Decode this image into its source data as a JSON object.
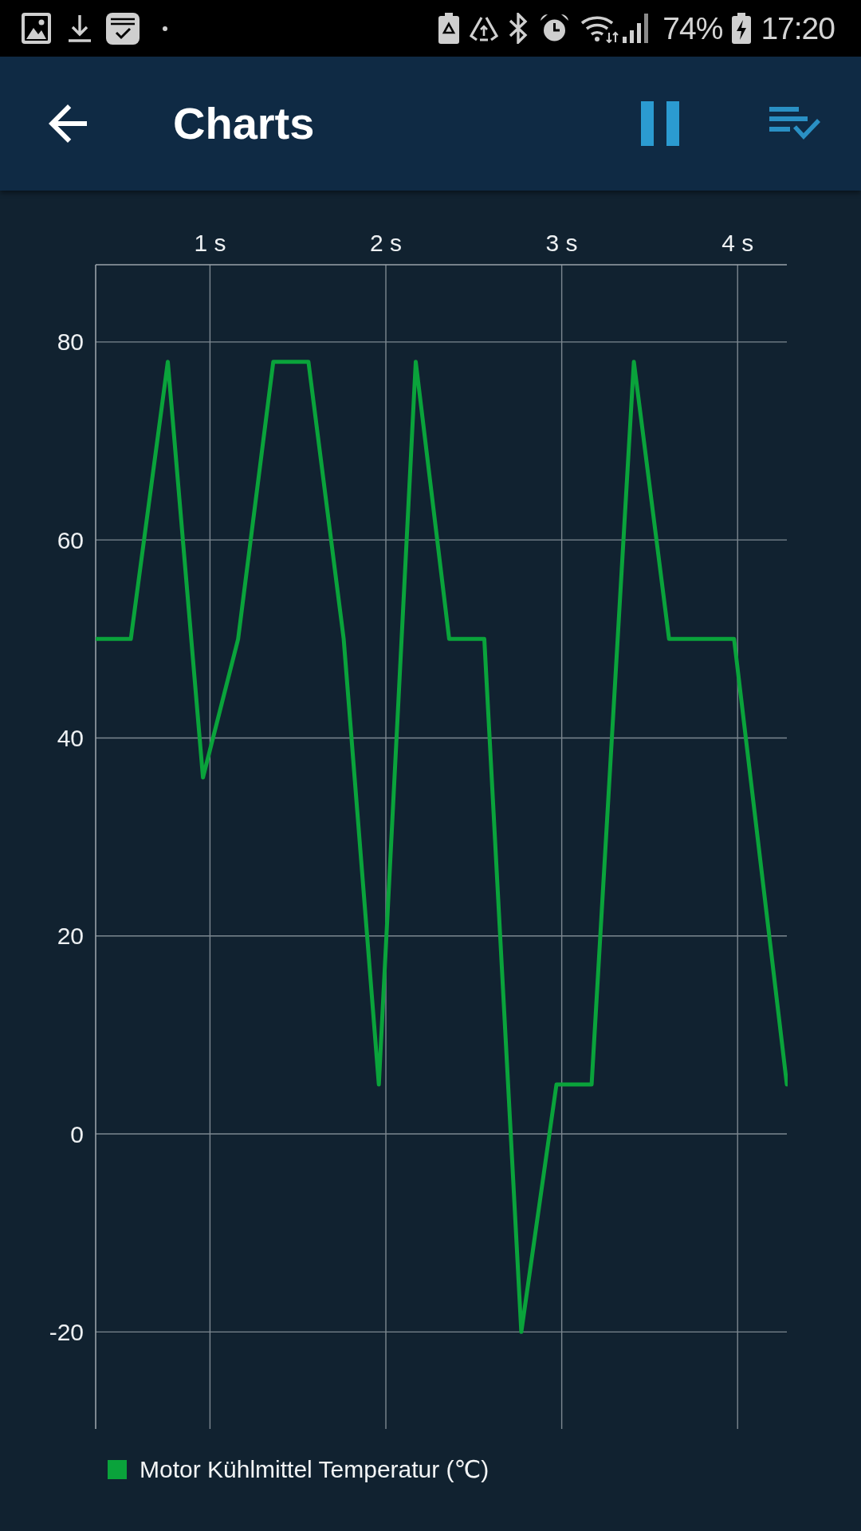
{
  "status_bar": {
    "battery": "74%",
    "time": "17:20"
  },
  "app_bar": {
    "title": "Charts"
  },
  "chart": {
    "chart_data": {
      "type": "line",
      "x": [
        0.35,
        0.55,
        0.76,
        0.96,
        1.16,
        1.36,
        1.56,
        1.76,
        1.96,
        2.17,
        2.36,
        2.56,
        2.77,
        2.97,
        3.17,
        3.41,
        3.61,
        3.79,
        3.98,
        4.28
      ],
      "series": [
        {
          "name": "Motor Kühlmittel Temperatur (℃)",
          "color": "#0aa33b",
          "values": [
            50,
            50,
            78,
            36,
            50,
            78,
            78,
            50,
            5,
            78,
            50,
            50,
            -20,
            5,
            5,
            78,
            50,
            50,
            50,
            5
          ]
        }
      ],
      "xlim": [
        0.35,
        4.28
      ],
      "ylim": [
        -29.8,
        87.8
      ],
      "xticks": [
        {
          "value": 1,
          "label": "1 s"
        },
        {
          "value": 2,
          "label": "2 s"
        },
        {
          "value": 3,
          "label": "3 s"
        },
        {
          "value": 4,
          "label": "4 s"
        }
      ],
      "yticks": [
        -20,
        0,
        20,
        40,
        60,
        80
      ],
      "grid": true
    }
  }
}
